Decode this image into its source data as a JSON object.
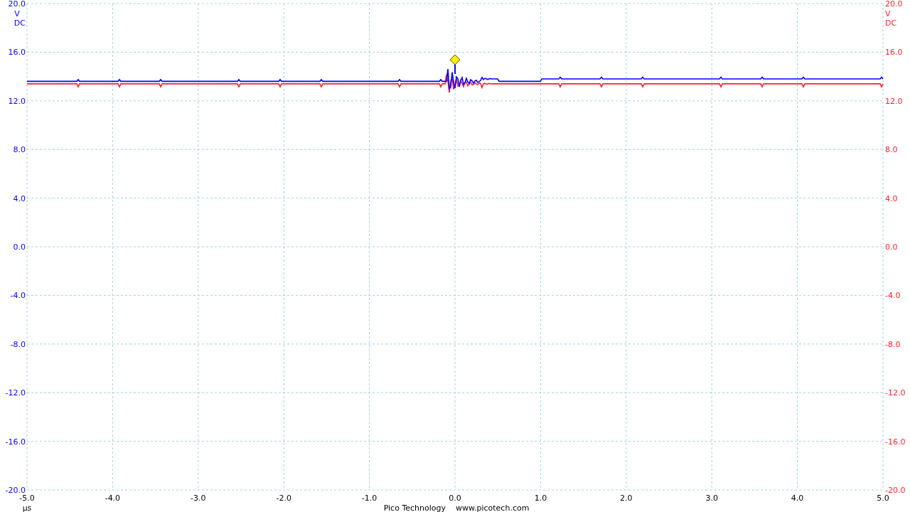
{
  "plot": {
    "channels": [
      {
        "color": "#0000ff",
        "unit": "V",
        "coupling": "DC",
        "ticks": [
          "20.0",
          "16.0",
          "12.0",
          "8.0",
          "4.0",
          "0.0",
          "-4.0",
          "-8.0",
          "-12.0",
          "-16.0",
          "-20.0"
        ]
      },
      {
        "color": "#ff2030",
        "unit": "V",
        "coupling": "DC",
        "ticks": [
          "20.0",
          "16.0",
          "12.0",
          "8.0",
          "4.0",
          "0.0",
          "-4.0",
          "-8.0",
          "-12.0",
          "-16.0",
          "-20.0"
        ]
      }
    ],
    "x_axis": {
      "ticks": [
        "-5.0",
        "-4.0",
        "-3.0",
        "-2.0",
        "-1.0",
        "0.0",
        "1.0",
        "2.0",
        "3.0",
        "4.0",
        "5.0"
      ],
      "unit": "µs"
    },
    "footer": {
      "company": "Pico Technology",
      "website": "www.picotech.com"
    }
  }
}
